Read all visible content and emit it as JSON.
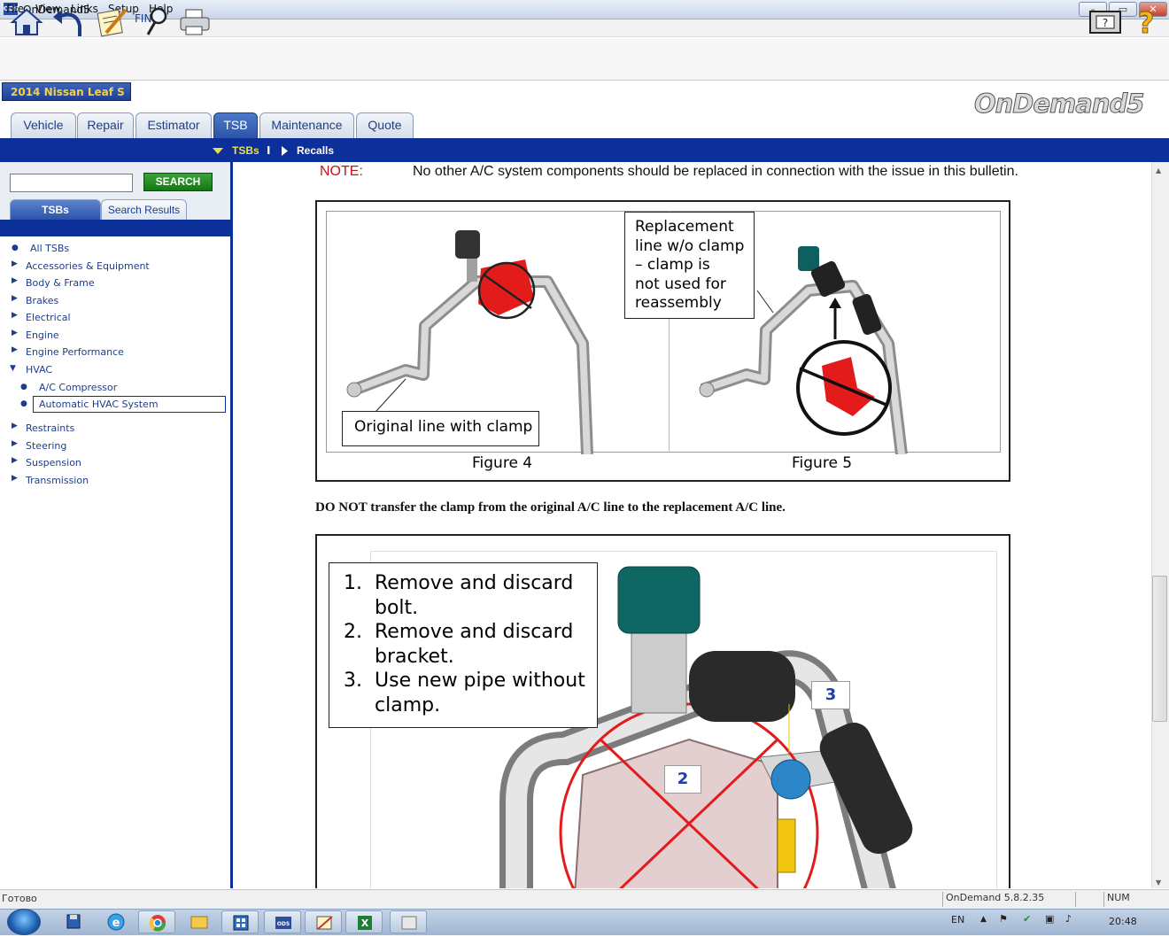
{
  "window": {
    "title": "OnDemand5",
    "app_icon_text": "ODS",
    "minimize": "–",
    "restore": "▭",
    "close": "✕"
  },
  "menu": [
    "File",
    "View",
    "Links",
    "Setup",
    "Help"
  ],
  "toolbar": {
    "find_label": "FIN"
  },
  "vehicle": "2014 Nissan Leaf S",
  "logo": "OnDemand5",
  "tabs": [
    {
      "label": "Vehicle",
      "active": false
    },
    {
      "label": "Repair",
      "active": false
    },
    {
      "label": "Estimator",
      "active": false
    },
    {
      "label": "TSB",
      "active": true
    },
    {
      "label": "Maintenance",
      "active": false
    },
    {
      "label": "Quote",
      "active": false
    }
  ],
  "breadcrumb": {
    "first": "TSBs",
    "separator": "I",
    "second": "Recalls"
  },
  "sidebar": {
    "search_value": "",
    "search_button": "SEARCH",
    "tab_tsbs": "TSBs",
    "tab_search_results": "Search Results",
    "tree": [
      {
        "label": "All TSBs",
        "type": "dot"
      },
      {
        "label": "Accessories & Equipment",
        "type": "arrow"
      },
      {
        "label": "Body & Frame",
        "type": "arrow"
      },
      {
        "label": "Brakes",
        "type": "arrow"
      },
      {
        "label": "Electrical",
        "type": "arrow"
      },
      {
        "label": "Engine",
        "type": "arrow"
      },
      {
        "label": "Engine Performance",
        "type": "arrow"
      },
      {
        "label": "HVAC",
        "type": "open"
      },
      {
        "label": "A/C Compressor",
        "type": "subdot"
      },
      {
        "label": "Automatic HVAC System",
        "type": "subdot",
        "selected": true
      },
      {
        "label": "Restraints",
        "type": "arrow"
      },
      {
        "label": "Steering",
        "type": "arrow"
      },
      {
        "label": "Suspension",
        "type": "arrow"
      },
      {
        "label": "Transmission",
        "type": "arrow"
      }
    ]
  },
  "content": {
    "note_label": "NOTE:",
    "note_text": "No other A/C system components should be replaced in connection with the issue in this bulletin.",
    "figure1": {
      "callout_left": "Original line with clamp",
      "callout_right": [
        "Replacement",
        "line w/o clamp",
        "– clamp is",
        "not used for",
        "reassembly"
      ],
      "caption_left": "Figure 4",
      "caption_right": "Figure 5"
    },
    "instruction": "DO NOT transfer the clamp from the original A/C line to the replacement A/C line.",
    "figure2": {
      "steps": [
        {
          "num": "1.",
          "line1": "Remove and discard",
          "line2": "bolt."
        },
        {
          "num": "2.",
          "line1": "Remove and discard",
          "line2": "bracket."
        },
        {
          "num": "3.",
          "line1": "Use new pipe without",
          "line2": "clamp."
        }
      ],
      "label_2": "2",
      "label_3": "3"
    }
  },
  "status": {
    "left": "Готово",
    "version": "OnDemand 5.8.2.35",
    "num": "NUM"
  },
  "taskbar": {
    "lang": "EN",
    "time": "20:48"
  }
}
